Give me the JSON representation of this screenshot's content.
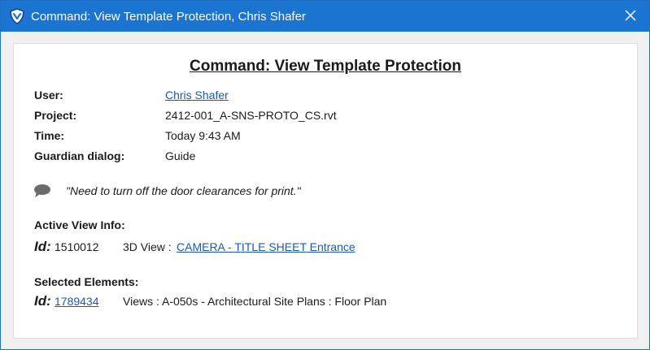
{
  "window": {
    "title": "Command: View Template Protection, Chris Shafer"
  },
  "heading": "Command: View Template Protection",
  "details": {
    "user_label": "User:",
    "user_value": "Chris Shafer",
    "project_label": "Project:",
    "project_value": "2412-001_A-SNS-PROTO_CS.rvt",
    "time_label": "Time:",
    "time_value": "Today 9:43 AM",
    "guardian_label": "Guardian dialog:",
    "guardian_value": "Guide"
  },
  "comment": "\"Need to turn off the door clearances for print.\"",
  "active_view": {
    "heading": "Active View Info:",
    "id_label": "Id:",
    "id_value": "1510012",
    "view_prefix": "3D View :",
    "view_name": "CAMERA - TITLE SHEET Entrance"
  },
  "selected": {
    "heading": "Selected Elements:",
    "id_label": "Id:",
    "id_value": "1789434",
    "description": "Views : A-050s - Architectural Site Plans : Floor Plan"
  },
  "icons": {
    "app": "guardian-logo-icon",
    "close": "close-icon",
    "comment": "speech-bubble-icon"
  },
  "colors": {
    "titlebar": "#1c74d1",
    "link": "#1a58b8"
  }
}
